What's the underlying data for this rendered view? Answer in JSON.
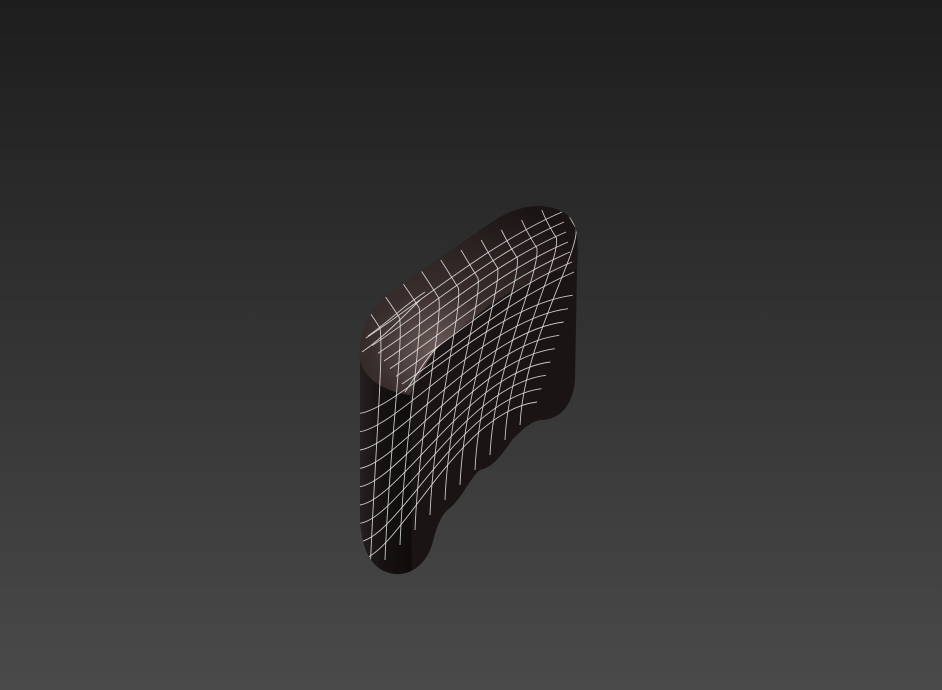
{
  "viewport": {
    "background_top": "#1d1d1d",
    "background_bottom": "#4a4a4a",
    "object": {
      "name": "rounded-box-mesh",
      "display_mode": "shaded-with-wireframe",
      "shade_color": "#1a1414",
      "highlight_color": "#6a5a58",
      "wire_color": "#e8e8e8"
    }
  }
}
